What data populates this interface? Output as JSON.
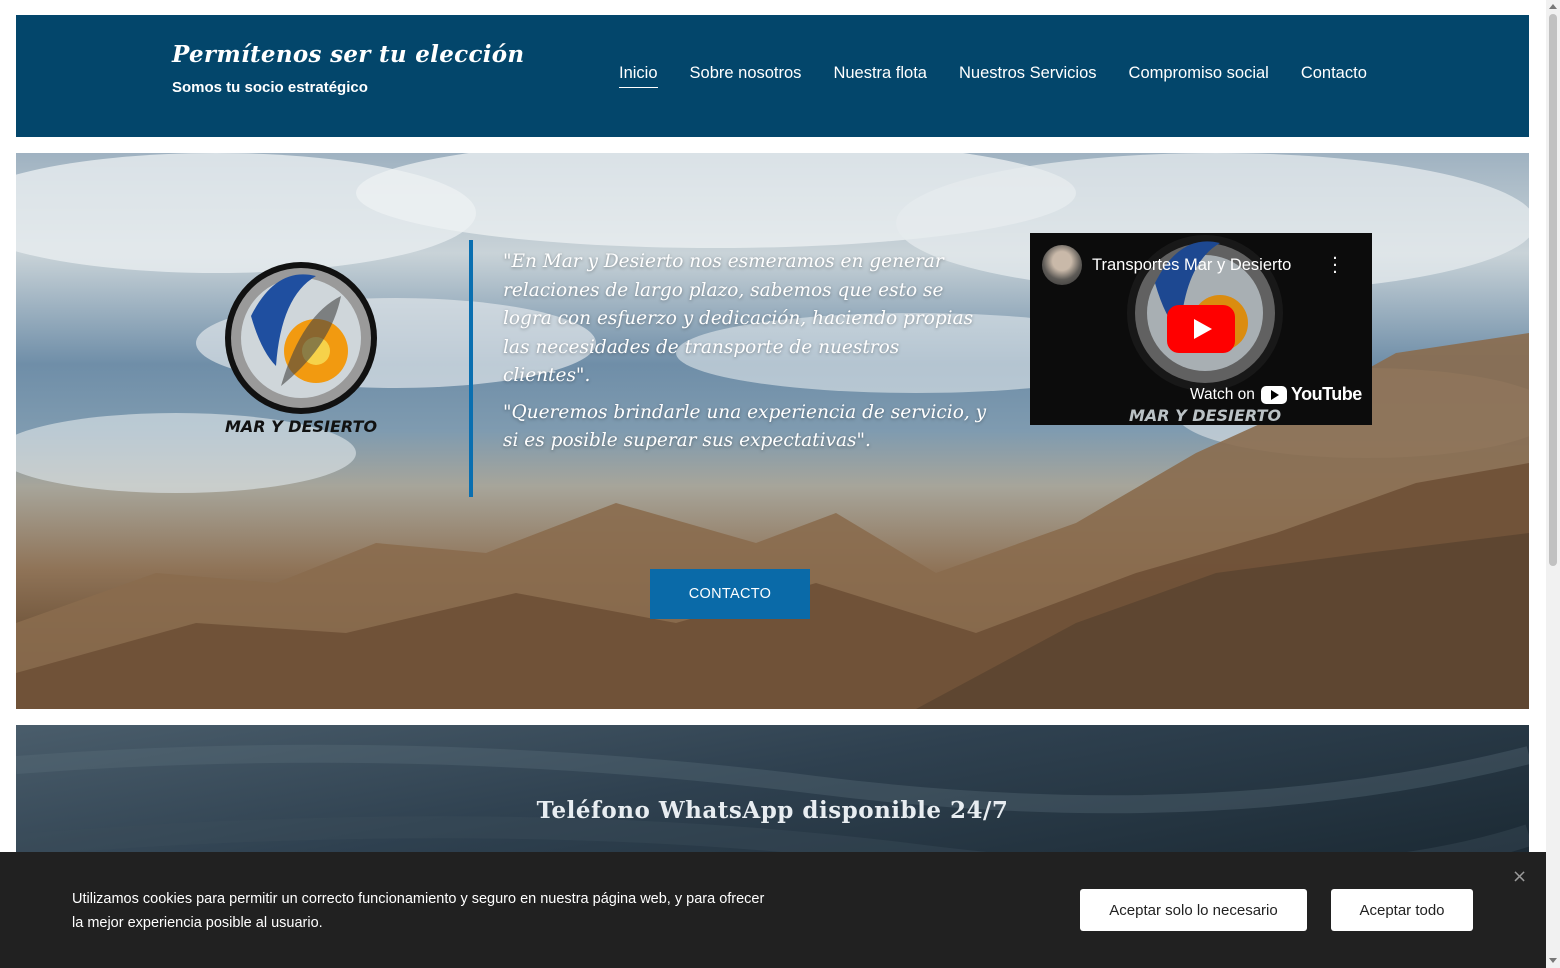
{
  "header": {
    "title": "Permítenos ser tu elección",
    "subtitle": "Somos tu socio estratégico",
    "background_color": "#03466b"
  },
  "nav": {
    "items": [
      {
        "label": "Inicio",
        "active": true
      },
      {
        "label": "Sobre nosotros",
        "active": false
      },
      {
        "label": "Nuestra flota",
        "active": false
      },
      {
        "label": "Nuestros Servicios",
        "active": false
      },
      {
        "label": "Compromiso social",
        "active": false
      },
      {
        "label": "Contacto",
        "active": false
      }
    ]
  },
  "hero": {
    "logo_text": "MAR Y DESIERTO",
    "quote_1": "\"En Mar y Desierto nos esmeramos en generar relaciones de largo plazo, sabemos que esto se logra con esfuerzo y dedicación, haciendo propias las necesidades de transporte de nuestros clientes\".",
    "quote_2": "\"Queremos brindarle una experiencia de servicio, y si es posible superar sus expectativas\".",
    "accent_color": "#0a6fb0",
    "cta_label": "CONTACTO"
  },
  "video": {
    "title": "Transportes Mar y Desierto",
    "watch_label": "Watch on",
    "platform": "YouTube",
    "menu_icon": "more-vertical-icon",
    "play_icon": "youtube-play-icon",
    "logo_caption": "MAR Y DESIERTO"
  },
  "section2": {
    "title": "Teléfono WhatsApp disponible 24/7"
  },
  "cookie": {
    "text": "Utilizamos cookies para permitir un correcto funcionamiento y seguro en nuestra página web, y para ofrecer la mejor experiencia posible al usuario.",
    "accept_necessary": "Aceptar solo lo necesario",
    "accept_all": "Aceptar todo",
    "close_icon": "close-icon",
    "close_glyph": "×"
  }
}
